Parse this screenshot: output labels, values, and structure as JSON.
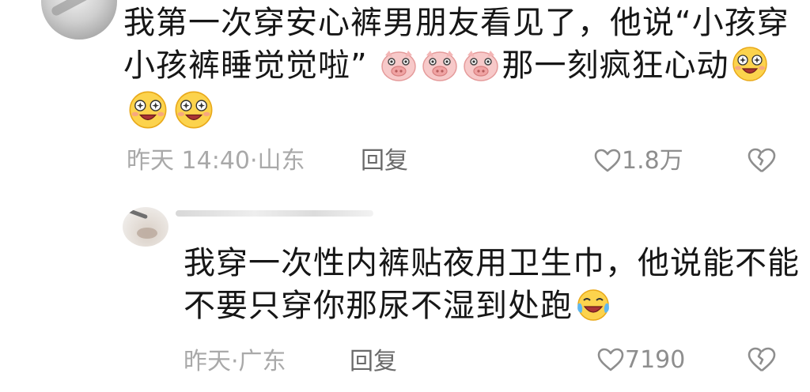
{
  "comments": [
    {
      "text_line1": "我第一次穿安心裤男朋友看见了，他说“小孩穿",
      "text_line2a": "小孩裤睡觉觉啦”",
      "text_line2b": "那一刻疯狂心动",
      "time": "昨天 14:40",
      "location": "山东",
      "reply_label": "回复",
      "likes": "1.8万",
      "emoji_inline": [
        "pig-emoji",
        "pig-emoji",
        "pig-emoji",
        "starry-eyed-emoji"
      ],
      "emoji_line3": [
        "starry-eyed-emoji",
        "starry-eyed-emoji"
      ]
    },
    {
      "text_line1": "我穿一次性内裤贴夜用卫生巾，他说能不能",
      "text_line2": "不要只穿你那尿不湿到处跑",
      "time": "昨天",
      "location": "广东",
      "reply_label": "回复",
      "likes": "7190",
      "emoji_inline": [
        "laughing-tears-emoji"
      ]
    }
  ],
  "colors": {
    "text": "#161616",
    "meta": "#a9a9a9",
    "reply": "#6a6a6a",
    "likes": "#8e8e8e"
  }
}
